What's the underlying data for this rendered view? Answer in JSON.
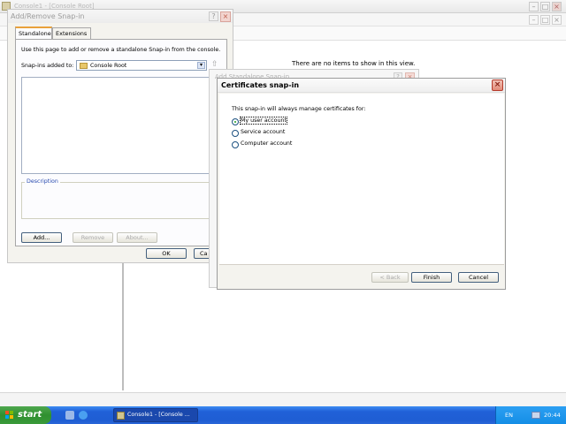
{
  "console": {
    "title": "Console1 - [Console Root]",
    "empty_message": "There are no items to show in this view."
  },
  "snapin_dialog": {
    "title": "Add/Remove Snap-in",
    "help": "?",
    "close": "×",
    "tabs": [
      {
        "label": "Standalone",
        "active": true
      },
      {
        "label": "Extensions",
        "active": false
      }
    ],
    "description_text": "Use this page to add or remove a standalone Snap-in from the console.",
    "snapins_added_label": "Snap-ins added to:",
    "snapins_added_value": "Console Root",
    "description_legend": "Description",
    "buttons": {
      "add": "Add...",
      "remove": "Remove",
      "about": "About...",
      "ok": "OK",
      "cancel": "Ca"
    }
  },
  "standalone_dialog": {
    "title": "Add Standalone Snap-in"
  },
  "cert_dialog": {
    "title": "Certificates snap-in",
    "close": "×",
    "prompt": "This snap-in will always manage certificates for:",
    "options": [
      {
        "label": "My user account",
        "checked": true
      },
      {
        "label": "Service account",
        "checked": false
      },
      {
        "label": "Computer account",
        "checked": false
      }
    ],
    "buttons": {
      "back": "< Back",
      "finish": "Finish",
      "cancel": "Cancel"
    }
  },
  "taskbar": {
    "start_label": "start",
    "task_label": "Console1 - [Console ...",
    "language": "EN",
    "clock": "20:44"
  }
}
